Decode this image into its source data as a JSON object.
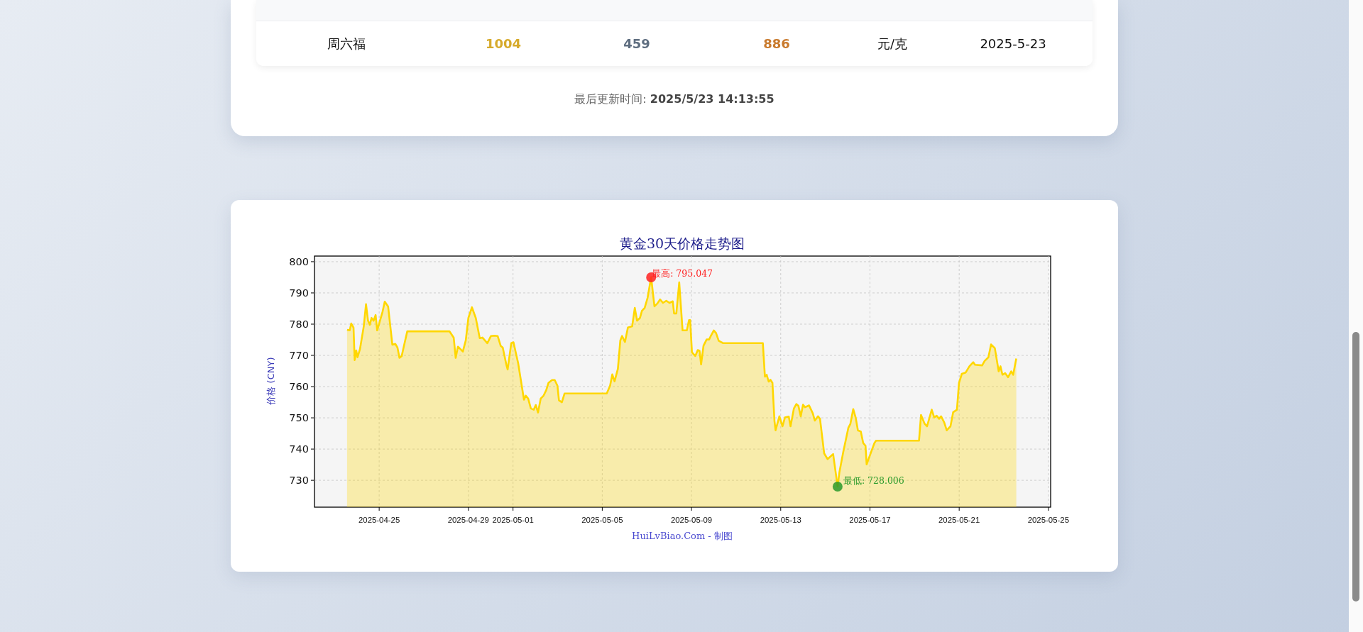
{
  "price_table": {
    "rows": [
      {
        "cells": [
          "周六福",
          "1004",
          "459",
          "886",
          "元/克",
          "2025-5-23"
        ]
      }
    ],
    "last_updated": "最后更新时间: **2025/5/23 14:13:55**"
  },
  "chart_card": {
    "credit": "HuiLvBiao.Com - 制图",
    "chart_data": {
      "type": "area",
      "title": "黄金30天价格走势图",
      "ylabel": "价格 (CNY)",
      "x": [
        "2025-04-23 13:26",
        "2025-04-23 16:19",
        "2025-04-23 18:00",
        "2025-04-23 20:24",
        "2025-04-23 21:36",
        "2025-04-23 23:17",
        "2025-04-24 00:43",
        "2025-04-24 03:22",
        "2025-04-24 07:26",
        "2025-04-24 09:50",
        "2025-04-24 12:00",
        "2025-04-24 13:55",
        "2025-04-24 15:50",
        "2025-04-24 18:00",
        "2025-04-24 20:10",
        "2025-04-24 21:50",
        "2025-04-25 00:00",
        "2025-04-25 03:36",
        "2025-04-25 06:00",
        "2025-04-25 09:36",
        "2025-04-25 14:10",
        "2025-04-25 17:17",
        "2025-04-25 19:41",
        "2025-04-25 21:50",
        "2025-04-26 00:14",
        "2025-04-26 02:38",
        "2025-04-26 06:14",
        "2025-04-28 03:36",
        "2025-04-28 08:10",
        "2025-04-28 10:19",
        "2025-04-28 12:43",
        "2025-04-28 18:00",
        "2025-04-28 21:07",
        "2025-04-29 00:00",
        "2025-04-29 03:50",
        "2025-04-29 07:55",
        "2025-04-29 12:14",
        "2025-04-29 15:07",
        "2025-04-29 20:24",
        "2025-04-30 00:14",
        "2025-04-30 03:50",
        "2025-04-30 07:26",
        "2025-04-30 10:48",
        "2025-04-30 12:58",
        "2025-04-30 16:48",
        "2025-04-30 18:14",
        "2025-04-30 22:05",
        "2025-05-01 00:29",
        "2025-05-01 05:31",
        "2025-05-01 11:46",
        "2025-05-01 13:41",
        "2025-05-01 16:19",
        "2025-05-01 19:12",
        "2025-05-01 22:19",
        "2025-05-02 00:29",
        "2025-05-02 02:53",
        "2025-05-02 05:46",
        "2025-05-02 08:53",
        "2025-05-02 11:46",
        "2025-05-02 14:10",
        "2025-05-02 18:00",
        "2025-05-02 20:53",
        "2025-05-02 23:46",
        "2025-05-03 01:26",
        "2025-05-03 04:34",
        "2025-05-03 07:26",
        "2025-05-05 04:48",
        "2025-05-05 08:24",
        "2025-05-05 10:48",
        "2025-05-05 13:12",
        "2025-05-05 16:48",
        "2025-05-05 19:26",
        "2025-05-05 21:22",
        "2025-05-06 00:29",
        "2025-05-06 03:36",
        "2025-05-06 08:10",
        "2025-05-06 11:02",
        "2025-05-06 13:26",
        "2025-05-06 16:34",
        "2025-05-06 18:43",
        "2025-05-06 21:36",
        "2025-05-07 00:43",
        "2025-05-07 04:34",
        "2025-05-07 08:10",
        "2025-05-07 11:17",
        "2025-05-07 14:10",
        "2025-05-07 17:17",
        "2025-05-07 20:53",
        "2025-05-08 00:14",
        "2025-05-08 03:50",
        "2025-05-08 05:17",
        "2025-05-08 07:41",
        "2025-05-08 10:48",
        "2025-05-08 14:24",
        "2025-05-08 18:58",
        "2025-05-08 21:22",
        "2025-05-08 22:34",
        "2025-05-09 00:29",
        "2025-05-09 04:05",
        "2025-05-09 06:43",
        "2025-05-09 08:38",
        "2025-05-09 10:19",
        "2025-05-09 12:58",
        "2025-05-09 16:19",
        "2025-05-09 18:58",
        "2025-05-09 21:07",
        "2025-05-10 00:00",
        "2025-05-10 02:24",
        "2025-05-10 05:17",
        "2025-05-10 10:05",
        "2025-05-12 04:48",
        "2025-05-12 06:58",
        "2025-05-12 08:53",
        "2025-05-12 11:02",
        "2025-05-12 12:58",
        "2025-05-12 15:07",
        "2025-05-12 17:17",
        "2025-05-12 18:29",
        "2025-05-12 22:34",
        "2025-05-13 01:55",
        "2025-05-13 04:34",
        "2025-05-13 08:38",
        "2025-05-13 10:34",
        "2025-05-13 14:10",
        "2025-05-13 16:48",
        "2025-05-13 18:58",
        "2025-05-13 21:36",
        "2025-05-14 00:00",
        "2025-05-14 02:10",
        "2025-05-14 06:29",
        "2025-05-14 10:34",
        "2025-05-14 12:43",
        "2025-05-14 16:05",
        "2025-05-14 18:14",
        "2025-05-14 22:48",
        "2025-05-15 02:24",
        "2025-05-15 08:24",
        "2025-05-15 13:12",
        "2025-05-15 15:07",
        "2025-05-15 19:12",
        "2025-05-16 00:43",
        "2025-05-16 02:53",
        "2025-05-16 06:00",
        "2025-05-16 08:38",
        "2025-05-16 11:02",
        "2025-05-16 14:10",
        "2025-05-16 16:48",
        "2025-05-16 19:12",
        "2025-05-16 20:24",
        "2025-05-17 01:12",
        "2025-05-17 04:48",
        "2025-05-17 06:29",
        "2025-05-19 04:48",
        "2025-05-19 06:58",
        "2025-05-19 10:48",
        "2025-05-19 13:26",
        "2025-05-19 18:29",
        "2025-05-19 21:07",
        "2025-05-19 23:46",
        "2025-05-20 02:24",
        "2025-05-20 04:34",
        "2025-05-20 07:55",
        "2025-05-20 10:34",
        "2025-05-20 14:38",
        "2025-05-20 17:31",
        "2025-05-20 21:36",
        "2025-05-20 23:46",
        "2025-05-21 02:53",
        "2025-05-21 06:58",
        "2025-05-21 11:02",
        "2025-05-21 15:07",
        "2025-05-21 17:02",
        "2025-05-22 00:43",
        "2025-05-22 03:22",
        "2025-05-22 07:26",
        "2025-05-22 10:19",
        "2025-05-22 14:24",
        "2025-05-22 18:29",
        "2025-05-22 20:24",
        "2025-05-22 22:34",
        "2025-05-23 01:26",
        "2025-05-23 04:34",
        "2025-05-23 07:55",
        "2025-05-23 10:05",
        "2025-05-23 13:26"
      ],
      "series": [
        {
          "color": "#ffd700",
          "values": [
            778.2,
            778,
            780.2,
            778.9,
            768.5,
            771.6,
            769.4,
            772,
            779.3,
            786.4,
            781.1,
            779.8,
            782,
            781.1,
            782.9,
            778,
            780.2,
            783.9,
            787.2,
            785.7,
            773.4,
            773.7,
            772.5,
            769.2,
            769.8,
            773,
            777.7,
            777.7,
            775.7,
            769.2,
            772.8,
            771.2,
            774.8,
            782,
            785.4,
            782,
            775.5,
            775.7,
            773.9,
            776.2,
            776.3,
            776.2,
            773,
            772.5,
            767.1,
            765.5,
            773.9,
            774.2,
            767.5,
            755.8,
            757.1,
            756.2,
            753,
            752.6,
            754.1,
            751.7,
            756.2,
            757.1,
            758.9,
            761.2,
            762.1,
            762.1,
            760.3,
            755.6,
            755,
            757.8,
            757.8,
            760.3,
            763.9,
            761.7,
            765.7,
            774.8,
            776.2,
            774.3,
            778.9,
            779.3,
            785.2,
            781.1,
            782,
            784.3,
            785.2,
            788.4,
            795.0,
            785.7,
            786.6,
            787.9,
            786.8,
            787.5,
            786.8,
            787.3,
            783.4,
            783.4,
            793.4,
            778,
            778,
            781.3,
            781.3,
            771,
            769.8,
            771.7,
            771.5,
            767.1,
            773.1,
            775.1,
            775.1,
            776.4,
            778,
            777.2,
            774.7,
            773.9,
            773.9,
            763.2,
            763.8,
            761.6,
            762.2,
            761.2,
            748.9,
            746,
            750.5,
            747.3,
            750.1,
            750.4,
            747.3,
            753,
            754.4,
            753.9,
            750.5,
            754.2,
            753.4,
            754,
            751.4,
            749.1,
            750.5,
            749.7,
            738.6,
            736.8,
            738.4,
            728.0,
            732.5,
            739,
            746.8,
            748,
            752.8,
            750.1,
            746,
            745.6,
            741.9,
            741.1,
            735.1,
            739,
            741.9,
            742.7,
            742.7,
            750.9,
            748.1,
            747.3,
            752.6,
            750.1,
            750.7,
            749.7,
            750.5,
            748.5,
            746,
            747.3,
            751.8,
            752.6,
            761.2,
            764.1,
            764.5,
            766.5,
            767.8,
            767,
            766.8,
            768.2,
            769.4,
            773.5,
            772.3,
            764.9,
            766.5,
            763.8,
            764.3,
            763,
            764.9,
            763.8,
            769
          ]
        }
      ],
      "xlim": [
        "2025-04-22 02:24",
        "2025-05-25 02:24"
      ],
      "ylim": [
        721.4,
        801.8
      ],
      "xticks": [
        {
          "value": "2025-04-25 00:00",
          "label": "2025-04-25"
        },
        {
          "value": "2025-04-29 00:00",
          "label": "2025-04-29"
        },
        {
          "value": "2025-05-01 00:00",
          "label": "2025-05-01"
        },
        {
          "value": "2025-05-05 00:00",
          "label": "2025-05-05"
        },
        {
          "value": "2025-05-09 00:00",
          "label": "2025-05-09"
        },
        {
          "value": "2025-05-13 00:00",
          "label": "2025-05-13"
        },
        {
          "value": "2025-05-17 00:00",
          "label": "2025-05-17"
        },
        {
          "value": "2025-05-21 00:00",
          "label": "2025-05-21"
        },
        {
          "value": "2025-05-25 00:00",
          "label": "2025-05-25"
        }
      ],
      "yticks": [
        730,
        740,
        750,
        760,
        770,
        780,
        790,
        800
      ],
      "grid": true,
      "annotations": [
        {
          "x": "2025-05-07 04:34",
          "y": 795.0,
          "text": "最高: 795.047"
        },
        {
          "x": "2025-05-15 13:12",
          "y": 728.0,
          "text": "最低: 728.006"
        }
      ]
    }
  }
}
